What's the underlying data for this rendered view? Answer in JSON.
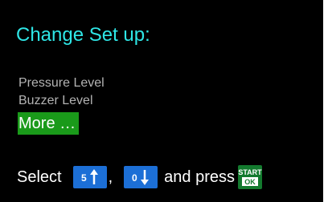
{
  "screen": {
    "title": "Change Set up:",
    "menu": [
      {
        "label": "Pressure Level",
        "selected": false
      },
      {
        "label": "Buzzer Level",
        "selected": false
      },
      {
        "label": "More …",
        "selected": true
      }
    ],
    "footer": {
      "select_text": "Select",
      "separator": ",",
      "and_press_text": "and press",
      "up_button": {
        "digit": "5",
        "icon": "arrow-up-icon"
      },
      "down_button": {
        "digit": "0",
        "icon": "arrow-down-icon"
      },
      "start_button": {
        "line1": "START",
        "line2": "OK"
      }
    }
  },
  "colors": {
    "background": "#000000",
    "title": "#2ee6e6",
    "menu_text": "#b3b3b3",
    "selected_bg": "#1a9a1a",
    "button_blue": "#1c6fd6",
    "button_green": "#137a2e"
  }
}
